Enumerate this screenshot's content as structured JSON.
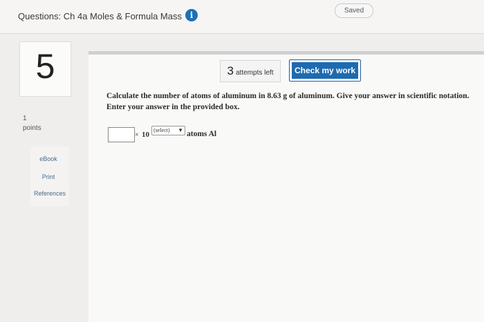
{
  "header": {
    "title": "Questions: Ch 4a Moles & Formula Mass",
    "info_icon": "info-icon",
    "saved_label": "Saved"
  },
  "question_meta": {
    "number": "5",
    "points_value": "1",
    "points_label": "points"
  },
  "side_links": {
    "ebook": "eBook",
    "print": "Print",
    "references": "References"
  },
  "toolbar": {
    "attempts_count": "3",
    "attempts_label": "attempts left",
    "check_label": "Check my work"
  },
  "question": {
    "text": "Calculate the number of atoms of aluminum in 8.63 g of aluminum. Give your answer in scientific notation. Enter your answer in the provided box.",
    "times_symbol": "×",
    "base": "10",
    "exponent_select": "(select)",
    "unit": "atoms Al",
    "answer_value": ""
  },
  "colors": {
    "accent": "#1e6ab0",
    "background": "#efeeec"
  }
}
